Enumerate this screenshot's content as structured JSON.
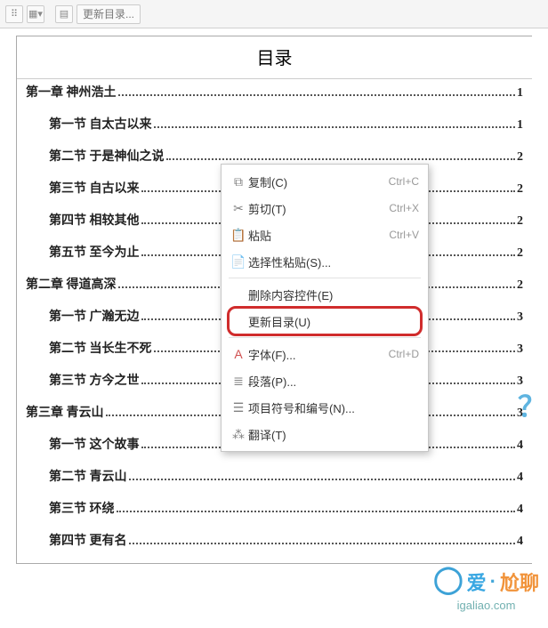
{
  "toolbar": {
    "update_toc_label": "更新目录..."
  },
  "toc": {
    "title": "目录",
    "entries": [
      {
        "level": 1,
        "text": "第一章  神州浩土",
        "page": "1"
      },
      {
        "level": 2,
        "text": "第一节 自太古以来",
        "page": "1"
      },
      {
        "level": 2,
        "text": "第二节 于是神仙之说",
        "page": "2"
      },
      {
        "level": 2,
        "text": "第三节 自古以来",
        "page": "2"
      },
      {
        "level": 2,
        "text": "第四节 相较其他",
        "page": "2"
      },
      {
        "level": 2,
        "text": "第五节 至今为止",
        "page": "2"
      },
      {
        "level": 1,
        "text": "第二章  得道高深",
        "page": "2"
      },
      {
        "level": 2,
        "text": "第一节 广瀚无边",
        "page": "3"
      },
      {
        "level": 2,
        "text": "第二节 当长生不死",
        "page": "3"
      },
      {
        "level": 2,
        "text": "第三节 方今之世",
        "page": "3"
      },
      {
        "level": 1,
        "text": "第三章  青云山",
        "page": "3"
      },
      {
        "level": 2,
        "text": "第一节 这个故事",
        "page": "4"
      },
      {
        "level": 2,
        "text": "第二节 青云山",
        "page": "4"
      },
      {
        "level": 2,
        "text": "第三节 环绕",
        "page": "4"
      },
      {
        "level": 2,
        "text": "第四节 更有名",
        "page": "4"
      }
    ]
  },
  "context_menu": {
    "copy": {
      "label": "复制(C)",
      "accel": "Ctrl+C",
      "icon": "copy-icon"
    },
    "cut": {
      "label": "剪切(T)",
      "accel": "Ctrl+X",
      "icon": "cut-icon"
    },
    "paste": {
      "label": "粘贴",
      "accel": "Ctrl+V",
      "icon": "paste-icon"
    },
    "paste_sp": {
      "label": "选择性粘贴(S)...",
      "icon": "paste-special-icon"
    },
    "del_ctrl": {
      "label": "删除内容控件(E)"
    },
    "update_toc": {
      "label": "更新目录(U)"
    },
    "font": {
      "label": "字体(F)...",
      "accel": "Ctrl+D",
      "icon": "font-icon"
    },
    "paragraph": {
      "label": "段落(P)...",
      "icon": "paragraph-icon"
    },
    "bullets": {
      "label": "项目符号和编号(N)...",
      "icon": "bullets-icon"
    },
    "translate": {
      "label": "翻译(T)",
      "icon": "translate-icon"
    }
  },
  "watermark": {
    "text1": "爱",
    "sep": "·",
    "text2": "尬聊",
    "url": "igaliao.com"
  },
  "question_mark": "？"
}
